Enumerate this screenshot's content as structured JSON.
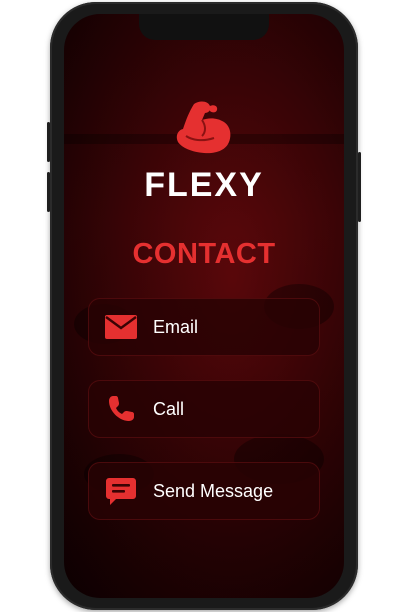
{
  "brand": {
    "name": "FLEXY",
    "logo_icon": "flexed-arm-icon"
  },
  "page": {
    "heading": "CONTACT"
  },
  "contact_options": [
    {
      "label": "Email",
      "icon": "envelope-icon"
    },
    {
      "label": "Call",
      "icon": "phone-icon"
    },
    {
      "label": "Send Message",
      "icon": "chat-message-icon"
    }
  ],
  "colors": {
    "accent": "#e53030",
    "button_bg": "#280204",
    "text": "#ffffff"
  }
}
